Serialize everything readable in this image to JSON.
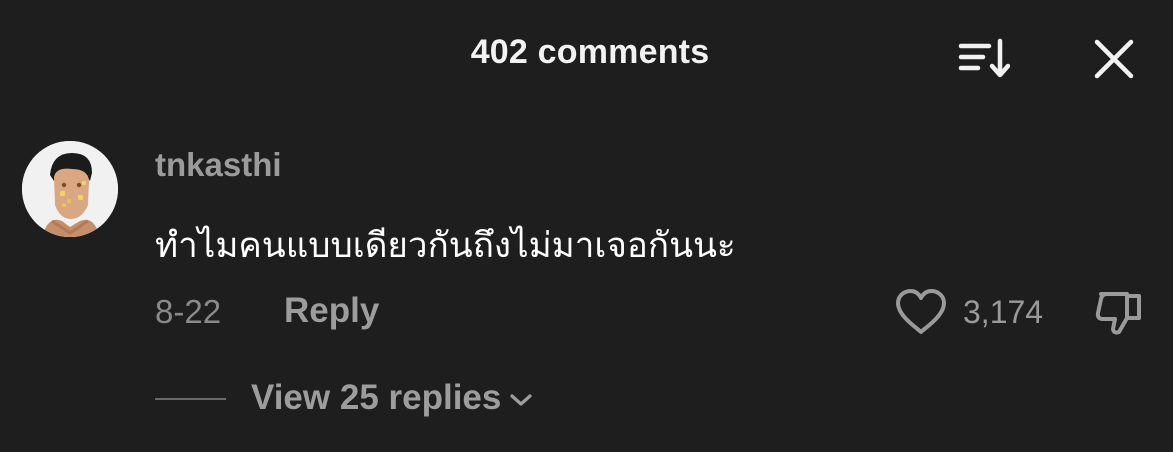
{
  "header": {
    "title": "402 comments",
    "sort_icon": "sort-descending-icon",
    "close_icon": "close-icon"
  },
  "comment": {
    "username": "tnkasthi",
    "text": "ทำไมคนแบบเดียวกันถึงไม่มาเจอกันนะ",
    "date": "8-22",
    "reply_label": "Reply",
    "like_count": "3,174",
    "like_icon": "heart-icon",
    "dislike_icon": "thumbs-down-icon"
  },
  "replies": {
    "label": "View 25 replies",
    "icon": "chevron-down-icon"
  },
  "colors": {
    "background": "#1e1e1e",
    "primary_text": "#ffffff",
    "secondary_text": "#9b9b9b"
  }
}
